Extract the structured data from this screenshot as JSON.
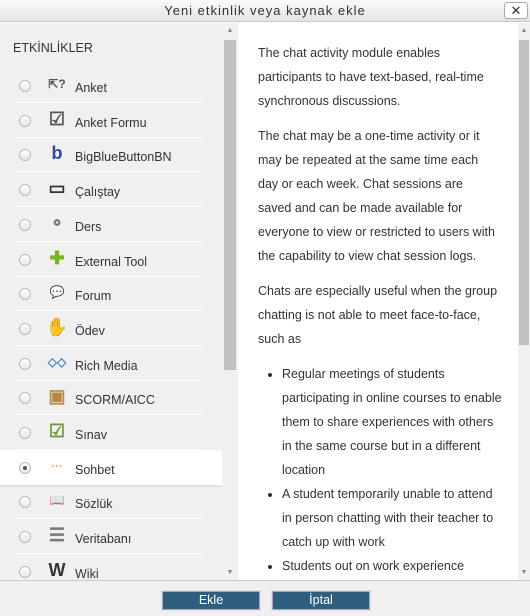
{
  "dialog": {
    "title": "Yeni etkinlik veya kaynak ekle",
    "close_label": "✕"
  },
  "activities": {
    "heading": "ETKİNLİKLER",
    "selected": "Sohbet",
    "items": [
      {
        "label": "Anket",
        "icon": "pointer-question-icon",
        "glyph": "⇱?"
      },
      {
        "label": "Anket Formu",
        "icon": "checkbox-form-icon",
        "glyph": "☑"
      },
      {
        "label": "BigBlueButtonBN",
        "icon": "bigbluebutton-icon",
        "glyph": "b"
      },
      {
        "label": "Çalıştay",
        "icon": "presentation-board-icon",
        "glyph": "▭"
      },
      {
        "label": "Ders",
        "icon": "flow-nodes-icon",
        "glyph": "⚬"
      },
      {
        "label": "External Tool",
        "icon": "puzzle-icon",
        "glyph": "✚"
      },
      {
        "label": "Forum",
        "icon": "speech-bubble-icon",
        "glyph": "💬"
      },
      {
        "label": "Ödev",
        "icon": "hand-paper-icon",
        "glyph": "✋"
      },
      {
        "label": "Rich Media",
        "icon": "rich-media-icon",
        "glyph": "◇◇"
      },
      {
        "label": "SCORM/AICC",
        "icon": "package-box-icon",
        "glyph": "▣"
      },
      {
        "label": "Sınav",
        "icon": "checklist-icon",
        "glyph": "☑"
      },
      {
        "label": "Sohbet",
        "icon": "chat-bubble-icon",
        "glyph": "···"
      },
      {
        "label": "Sözlük",
        "icon": "book-icon",
        "glyph": "📖"
      },
      {
        "label": "Veritabanı",
        "icon": "database-icon",
        "glyph": "☰"
      },
      {
        "label": "Wiki",
        "icon": "wiki-icon",
        "glyph": "W"
      }
    ]
  },
  "description": {
    "p1": "The chat activity module enables participants to have text-based, real-time synchronous discussions.",
    "p2": "The chat may be a one-time activity or it may be repeated at the same time each day or each week. Chat sessions are saved and can be made available for everyone to view or restricted to users with the capability to view chat session logs.",
    "p3": "Chats are especially useful when the group chatting is not able to meet face-to-face, such as",
    "bullets": [
      "Regular meetings of students participating in online courses to enable them to share experiences with others in the same course but in a different location",
      "A student temporarily unable to attend in person chatting with their teacher to catch up with work",
      "Students out on work experience"
    ]
  },
  "buttons": {
    "add": "Ekle",
    "cancel": "İptal"
  }
}
